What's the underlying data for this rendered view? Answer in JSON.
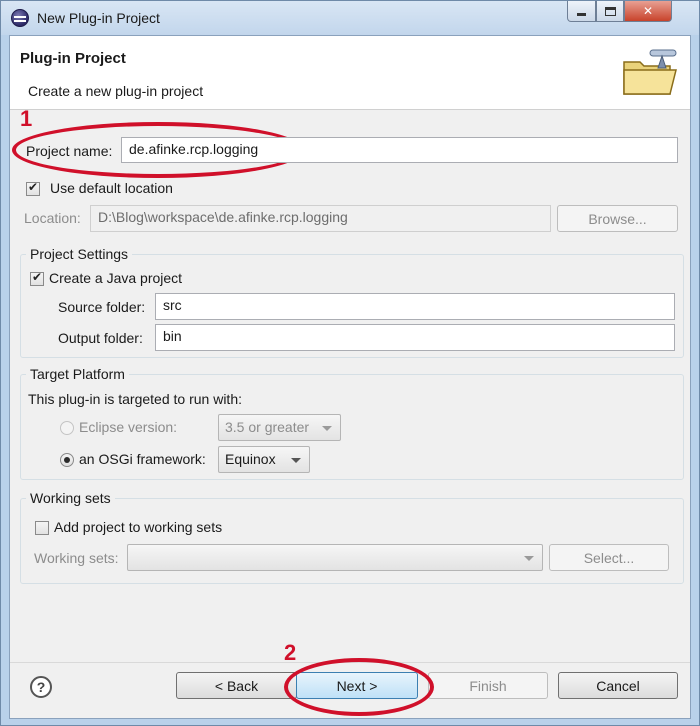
{
  "window": {
    "title": "New Plug-in Project"
  },
  "banner": {
    "title": "Plug-in Project",
    "description": "Create a new plug-in project"
  },
  "annotations": {
    "marker_1": "1",
    "marker_2": "2",
    "color": "#d0102a"
  },
  "project": {
    "name_label": "Project name:",
    "name_value": "de.afinke.rcp.logging",
    "use_default_location_label": "Use default location",
    "use_default_location_checked": true,
    "location_label": "Location:",
    "location_value": "D:\\Blog\\workspace\\de.afinke.rcp.logging",
    "browse_label": "Browse..."
  },
  "project_settings": {
    "group_title": "Project Settings",
    "create_java_label": "Create a Java project",
    "create_java_checked": true,
    "source_folder_label": "Source folder:",
    "source_folder_value": "src",
    "output_folder_label": "Output folder:",
    "output_folder_value": "bin"
  },
  "target_platform": {
    "group_title": "Target Platform",
    "description": "This plug-in is targeted to run with:",
    "eclipse_version_label": "Eclipse version:",
    "eclipse_version_value": "3.5 or greater",
    "osgi_label": "an OSGi framework:",
    "osgi_value": "Equinox",
    "selected": "osgi"
  },
  "working_sets": {
    "group_title": "Working sets",
    "add_label": "Add project to working sets",
    "add_checked": false,
    "sets_label": "Working sets:",
    "sets_value": "",
    "select_label": "Select..."
  },
  "footer": {
    "help_icon": "help-icon",
    "help_glyph": "?",
    "back_label": "< Back",
    "next_label": "Next >",
    "finish_label": "Finish",
    "cancel_label": "Cancel"
  }
}
